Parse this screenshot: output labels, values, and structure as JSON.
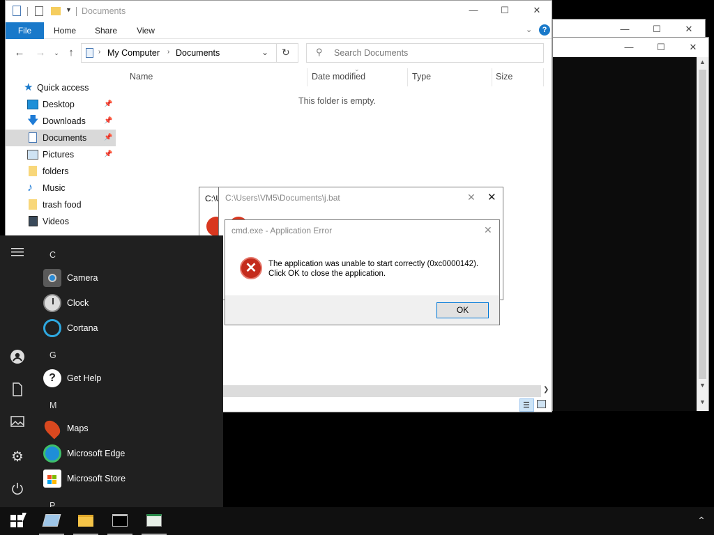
{
  "explorer": {
    "title": "Documents",
    "tabs": [
      "File",
      "Home",
      "Share",
      "View"
    ],
    "breadcrumb": [
      "My Computer",
      "Documents"
    ],
    "search_placeholder": "Search Documents",
    "columns": [
      "Name",
      "Date modified",
      "Type",
      "Size"
    ],
    "empty_message": "This folder is empty.",
    "nav": [
      {
        "label": "Quick access",
        "icon": "star-icon"
      },
      {
        "label": "Desktop",
        "icon": "desktop-icon",
        "pinned": true
      },
      {
        "label": "Downloads",
        "icon": "download-icon",
        "pinned": true
      },
      {
        "label": "Documents",
        "icon": "document-icon",
        "pinned": true,
        "selected": true
      },
      {
        "label": "Pictures",
        "icon": "picture-icon",
        "pinned": true
      },
      {
        "label": "folders",
        "icon": "folder-icon"
      },
      {
        "label": "Music",
        "icon": "music-icon"
      },
      {
        "label": "trash food",
        "icon": "folder-icon"
      },
      {
        "label": "Videos",
        "icon": "video-icon"
      }
    ]
  },
  "bat_dialog": {
    "title": "C:\\Users\\VM5\\Documents\\j.bat",
    "behind_title": "C:\\U"
  },
  "error_dialog": {
    "title": "cmd.exe - Application Error",
    "message_line1": "The application was unable to start correctly (0xc0000142).",
    "message_line2": "Click OK to close the application.",
    "ok_label": "OK"
  },
  "start_menu": {
    "letters": {
      "c": "C",
      "g": "G",
      "m": "M",
      "p": "P"
    },
    "apps": {
      "camera": "Camera",
      "clock": "Clock",
      "cortana": "Cortana",
      "get_help": "Get Help",
      "maps": "Maps",
      "edge": "Microsoft Edge",
      "store": "Microsoft Store"
    }
  },
  "colors": {
    "accent": "#1979ca",
    "error_red": "#c42b1c",
    "start_bg": "#202020",
    "taskbar_bg": "#101010"
  }
}
